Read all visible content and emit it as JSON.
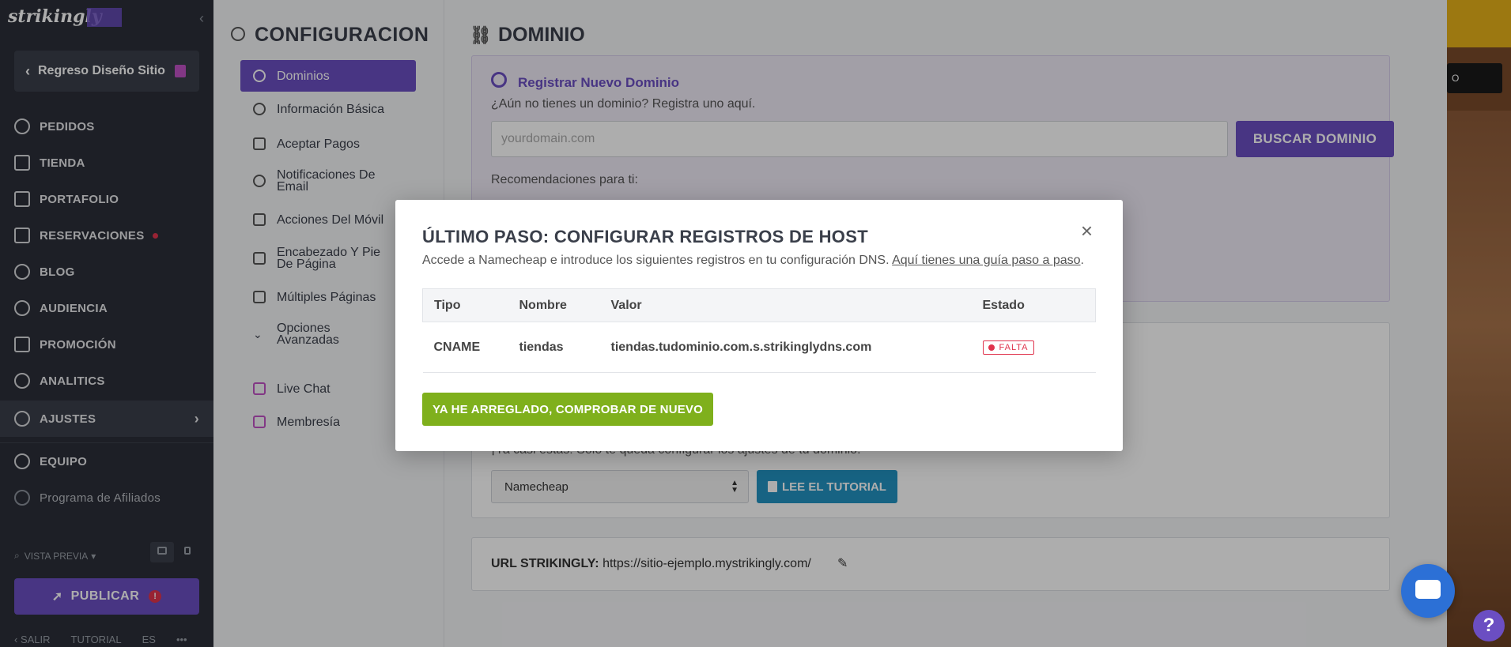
{
  "sidebar": {
    "logo": "strikingly",
    "back_label": "Regreso Diseño Sitio",
    "items": [
      {
        "label": "PEDIDOS"
      },
      {
        "label": "TIENDA"
      },
      {
        "label": "PORTAFOLIO"
      },
      {
        "label": "RESERVACIONES"
      },
      {
        "label": "BLOG"
      },
      {
        "label": "AUDIENCIA"
      },
      {
        "label": "PROMOCIÓN"
      },
      {
        "label": "ANALITICS"
      },
      {
        "label": "AJUSTES"
      },
      {
        "label": "EQUIPO"
      },
      {
        "label": "Programa de Afiliados"
      }
    ],
    "preview_label": "VISTA PREVIA",
    "publish_label": "PUBLICAR",
    "publish_warning": "!",
    "footer": {
      "exit": "SALIR",
      "tutorial": "TUTORIAL",
      "lang": "ES",
      "more": "•••"
    }
  },
  "settings": {
    "title": "CONFIGURACION",
    "items": [
      {
        "label": "Dominios"
      },
      {
        "label": "Información Básica"
      },
      {
        "label": "Aceptar Pagos"
      },
      {
        "label": "Notificaciones De Email"
      },
      {
        "label": "Acciones Del Móvil"
      },
      {
        "label": "Encabezado Y Pie De Página"
      },
      {
        "label": "Múltiples Páginas"
      },
      {
        "label": "Opciones Avanzadas"
      },
      {
        "label": "Live Chat"
      },
      {
        "label": "Membresía"
      }
    ]
  },
  "main": {
    "title": "DOMINIO",
    "register": {
      "heading": "Registrar Nuevo Dominio",
      "subtitle": "¿Aún no tienes un dominio? Registra uno aquí.",
      "input_placeholder": "yourdomain.com",
      "search_button": "BUSCAR DOMINIO",
      "recommendations_label": "Recomendaciones para ti:"
    },
    "connect": {
      "text": "¡Ya casi estás! Solo te queda configurar los ajustes de tu dominio:",
      "provider": "Namecheap",
      "tutorial_button": "LEE EL TUTORIAL"
    },
    "url": {
      "label": "URL STRIKINGLY:",
      "value": "https://sitio-ejemplo.mystrikingly.com/"
    }
  },
  "modal": {
    "title": "ÚLTIMO PASO: CONFIGURAR REGISTROS DE HOST",
    "description": "Accede a Namecheap e introduce los siguientes registros en tu configuración DNS.",
    "guide_link": "Aquí tienes una guía paso a paso",
    "close": "×",
    "table": {
      "headers": [
        "Tipo",
        "Nombre",
        "Valor",
        "Estado"
      ],
      "rows": [
        {
          "type": "CNAME",
          "name": "tiendas",
          "value": "tiendas.tudominio.com.s.strikinglydns.com",
          "status": "FALTA"
        }
      ]
    },
    "check_button": "YA HE ARREGLADO, COMPROBAR DE NUEVO"
  },
  "preview_strip": {
    "label": "O"
  },
  "help": "?",
  "colors": {
    "brand": "#6b4ec2",
    "sidebar_bg": "#2b2f38",
    "success": "#7fb01c",
    "danger": "#e0344d",
    "info": "#2293c2",
    "chat": "#2c70d6"
  }
}
